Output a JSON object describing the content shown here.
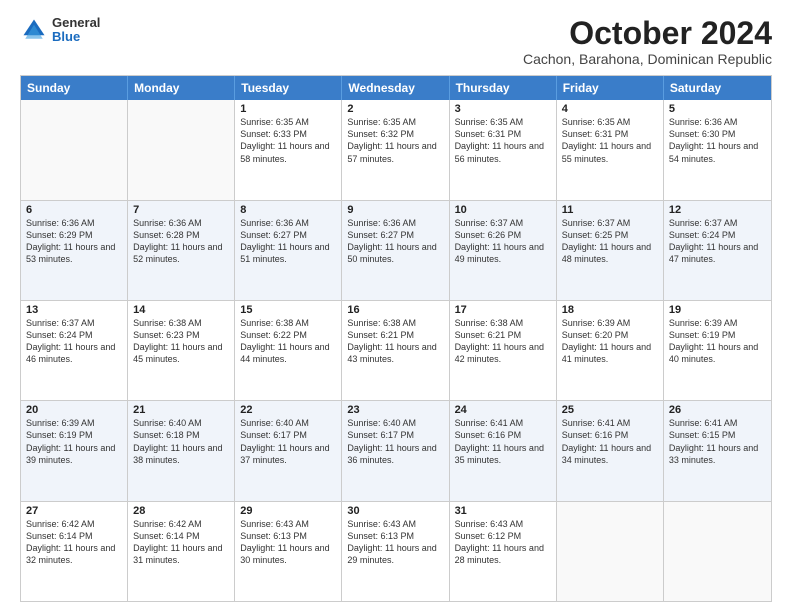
{
  "logo": {
    "general": "General",
    "blue": "Blue"
  },
  "header": {
    "month": "October 2024",
    "location": "Cachon, Barahona, Dominican Republic"
  },
  "days_of_week": [
    "Sunday",
    "Monday",
    "Tuesday",
    "Wednesday",
    "Thursday",
    "Friday",
    "Saturday"
  ],
  "weeks": [
    [
      {
        "day": "",
        "info": ""
      },
      {
        "day": "",
        "info": ""
      },
      {
        "day": "1",
        "info": "Sunrise: 6:35 AM\nSunset: 6:33 PM\nDaylight: 11 hours and 58 minutes."
      },
      {
        "day": "2",
        "info": "Sunrise: 6:35 AM\nSunset: 6:32 PM\nDaylight: 11 hours and 57 minutes."
      },
      {
        "day": "3",
        "info": "Sunrise: 6:35 AM\nSunset: 6:31 PM\nDaylight: 11 hours and 56 minutes."
      },
      {
        "day": "4",
        "info": "Sunrise: 6:35 AM\nSunset: 6:31 PM\nDaylight: 11 hours and 55 minutes."
      },
      {
        "day": "5",
        "info": "Sunrise: 6:36 AM\nSunset: 6:30 PM\nDaylight: 11 hours and 54 minutes."
      }
    ],
    [
      {
        "day": "6",
        "info": "Sunrise: 6:36 AM\nSunset: 6:29 PM\nDaylight: 11 hours and 53 minutes."
      },
      {
        "day": "7",
        "info": "Sunrise: 6:36 AM\nSunset: 6:28 PM\nDaylight: 11 hours and 52 minutes."
      },
      {
        "day": "8",
        "info": "Sunrise: 6:36 AM\nSunset: 6:27 PM\nDaylight: 11 hours and 51 minutes."
      },
      {
        "day": "9",
        "info": "Sunrise: 6:36 AM\nSunset: 6:27 PM\nDaylight: 11 hours and 50 minutes."
      },
      {
        "day": "10",
        "info": "Sunrise: 6:37 AM\nSunset: 6:26 PM\nDaylight: 11 hours and 49 minutes."
      },
      {
        "day": "11",
        "info": "Sunrise: 6:37 AM\nSunset: 6:25 PM\nDaylight: 11 hours and 48 minutes."
      },
      {
        "day": "12",
        "info": "Sunrise: 6:37 AM\nSunset: 6:24 PM\nDaylight: 11 hours and 47 minutes."
      }
    ],
    [
      {
        "day": "13",
        "info": "Sunrise: 6:37 AM\nSunset: 6:24 PM\nDaylight: 11 hours and 46 minutes."
      },
      {
        "day": "14",
        "info": "Sunrise: 6:38 AM\nSunset: 6:23 PM\nDaylight: 11 hours and 45 minutes."
      },
      {
        "day": "15",
        "info": "Sunrise: 6:38 AM\nSunset: 6:22 PM\nDaylight: 11 hours and 44 minutes."
      },
      {
        "day": "16",
        "info": "Sunrise: 6:38 AM\nSunset: 6:21 PM\nDaylight: 11 hours and 43 minutes."
      },
      {
        "day": "17",
        "info": "Sunrise: 6:38 AM\nSunset: 6:21 PM\nDaylight: 11 hours and 42 minutes."
      },
      {
        "day": "18",
        "info": "Sunrise: 6:39 AM\nSunset: 6:20 PM\nDaylight: 11 hours and 41 minutes."
      },
      {
        "day": "19",
        "info": "Sunrise: 6:39 AM\nSunset: 6:19 PM\nDaylight: 11 hours and 40 minutes."
      }
    ],
    [
      {
        "day": "20",
        "info": "Sunrise: 6:39 AM\nSunset: 6:19 PM\nDaylight: 11 hours and 39 minutes."
      },
      {
        "day": "21",
        "info": "Sunrise: 6:40 AM\nSunset: 6:18 PM\nDaylight: 11 hours and 38 minutes."
      },
      {
        "day": "22",
        "info": "Sunrise: 6:40 AM\nSunset: 6:17 PM\nDaylight: 11 hours and 37 minutes."
      },
      {
        "day": "23",
        "info": "Sunrise: 6:40 AM\nSunset: 6:17 PM\nDaylight: 11 hours and 36 minutes."
      },
      {
        "day": "24",
        "info": "Sunrise: 6:41 AM\nSunset: 6:16 PM\nDaylight: 11 hours and 35 minutes."
      },
      {
        "day": "25",
        "info": "Sunrise: 6:41 AM\nSunset: 6:16 PM\nDaylight: 11 hours and 34 minutes."
      },
      {
        "day": "26",
        "info": "Sunrise: 6:41 AM\nSunset: 6:15 PM\nDaylight: 11 hours and 33 minutes."
      }
    ],
    [
      {
        "day": "27",
        "info": "Sunrise: 6:42 AM\nSunset: 6:14 PM\nDaylight: 11 hours and 32 minutes."
      },
      {
        "day": "28",
        "info": "Sunrise: 6:42 AM\nSunset: 6:14 PM\nDaylight: 11 hours and 31 minutes."
      },
      {
        "day": "29",
        "info": "Sunrise: 6:43 AM\nSunset: 6:13 PM\nDaylight: 11 hours and 30 minutes."
      },
      {
        "day": "30",
        "info": "Sunrise: 6:43 AM\nSunset: 6:13 PM\nDaylight: 11 hours and 29 minutes."
      },
      {
        "day": "31",
        "info": "Sunrise: 6:43 AM\nSunset: 6:12 PM\nDaylight: 11 hours and 28 minutes."
      },
      {
        "day": "",
        "info": ""
      },
      {
        "day": "",
        "info": ""
      }
    ]
  ]
}
